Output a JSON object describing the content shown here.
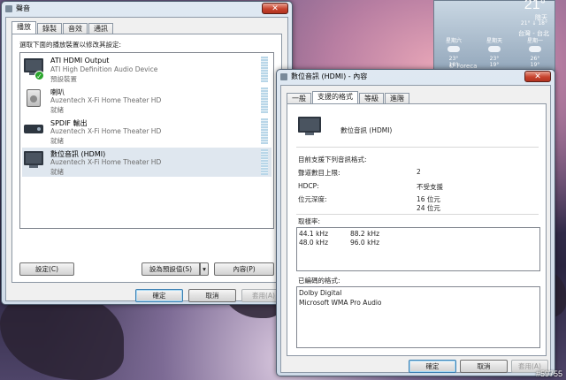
{
  "weather": {
    "temperature": "21°",
    "condition": "陰天",
    "range": "21° ↓ 18°",
    "location": "台灣 - 台北",
    "days": [
      {
        "label": "星期六",
        "hi": "23°",
        "lo": "18°",
        "icon": "cloud-icon"
      },
      {
        "label": "星期天",
        "hi": "23°",
        "lo": "19°",
        "icon": "cloud-icon"
      },
      {
        "label": "星期一",
        "hi": "26°",
        "lo": "19°",
        "icon": "cloud-icon"
      }
    ],
    "brand": "© Foreca"
  },
  "sound_window": {
    "title": "聲音",
    "tabs": [
      "播放",
      "錄製",
      "音效",
      "通訊"
    ],
    "active_tab": 0,
    "instruction": "選取下面的播放裝置以修改其設定:",
    "devices": [
      {
        "name": "ATI HDMI Output",
        "description": "ATI High Definition Audio Device",
        "status": "預設裝置",
        "icon": "monitor-icon",
        "is_default": true
      },
      {
        "name": "喇叭",
        "description": "Auzentech X-Fi Home Theater HD",
        "status": "就緒",
        "icon": "speaker-icon",
        "is_default": false
      },
      {
        "name": "SPDIF 輸出",
        "description": "Auzentech X-Fi Home Theater HD",
        "status": "就緒",
        "icon": "spdif-icon",
        "is_default": false
      },
      {
        "name": "數位音訊 (HDMI)",
        "description": "Auzentech X-Fi Home Theater HD",
        "status": "就緒",
        "icon": "monitor-icon",
        "is_default": false
      }
    ],
    "selected_device": 3,
    "configure_label": "設定(C)",
    "set_default_label": "設為預設值(S)",
    "properties_label": "內容(P)",
    "ok_label": "確定",
    "cancel_label": "取消",
    "apply_label": "套用(A)"
  },
  "props_window": {
    "title": "數位音訊 (HDMI) - 內容",
    "tabs": [
      "一般",
      "支援的格式",
      "等級",
      "進階"
    ],
    "active_tab": 1,
    "device_name": "數位音訊 (HDMI)",
    "section_title": "目前支援下列音訊格式:",
    "rows": [
      {
        "label": "聲道數目上限:",
        "value": "2"
      },
      {
        "label": "HDCP:",
        "value": "不受支援"
      },
      {
        "label": "位元深度:",
        "value": "16 位元"
      },
      {
        "label": "",
        "value": "24 位元"
      }
    ],
    "sample_rate_label": "取樣率:",
    "sample_rates": [
      [
        "44.1 kHz",
        "88.2 kHz"
      ],
      [
        "48.0 kHz",
        "96.0 kHz"
      ]
    ],
    "encoded_label": "已編碼的格式:",
    "encoded_formats": [
      "Dolby Digital",
      "Microsoft WMA Pro Audio"
    ],
    "ok_label": "確定",
    "cancel_label": "取消",
    "apply_label": "套用(A)"
  },
  "watermark": "#59755"
}
